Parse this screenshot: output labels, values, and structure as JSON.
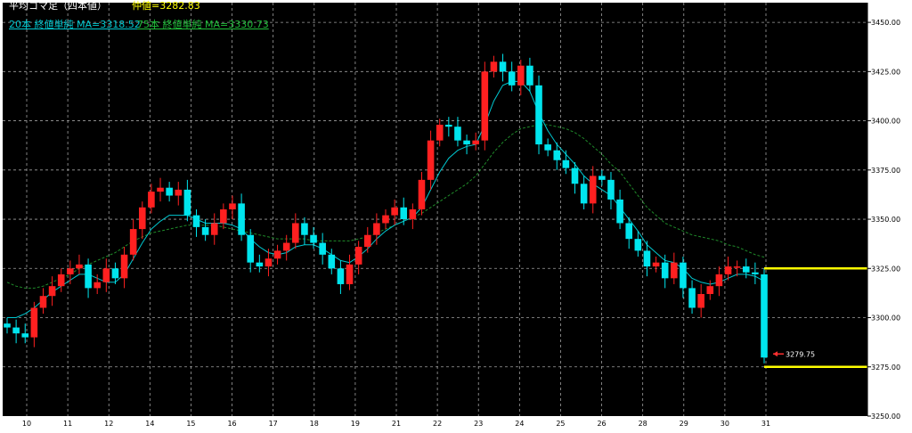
{
  "header": {
    "title": "平均コマ足（四本値）",
    "mid_price": "仲値=3282.83",
    "ma20_label": "20本 終値単純 MA=3318.52",
    "ma75_label": "75本 終値単純 MA=3330.73"
  },
  "colors": {
    "background": "#000000",
    "grid": "#a0a0a0",
    "up_candle": "#ff2020",
    "down_candle": "#00e5ee",
    "ma20": "#00c8d0",
    "ma75": "#1f8a2a",
    "price_line": "#ffff00",
    "title_text": "#ffffff",
    "mid_price_text": "#ffff00",
    "axis_text": "#ffffff"
  },
  "chart_data": {
    "type": "line",
    "title": "平均コマ足（四本値）",
    "ylim": [
      3250,
      3460
    ],
    "y_ticks": [
      "3450.00",
      "3425.00",
      "3400.00",
      "3375.00",
      "3350.00",
      "3325.00",
      "3300.00",
      "3275.00",
      "3250.00"
    ],
    "x_ticks": [
      "10",
      "11",
      "12",
      "14",
      "15",
      "16",
      "17",
      "18",
      "19",
      "21",
      "22",
      "23",
      "24",
      "25",
      "26",
      "28",
      "29",
      "30",
      "31"
    ],
    "series": [
      {
        "name": "平均コマ足",
        "kind": "candles",
        "values": [
          3295,
          3292,
          3290,
          3305,
          3311,
          3316,
          3322,
          3325,
          3327,
          3315,
          3318,
          3325,
          3320,
          3332,
          3345,
          3356,
          3364,
          3366,
          3362,
          3365,
          3352,
          3346,
          3342,
          3348,
          3355,
          3358,
          3342,
          3328,
          3326,
          3330,
          3334,
          3338,
          3348,
          3342,
          3338,
          3332,
          3325,
          3317,
          3327,
          3336,
          3342,
          3348,
          3352,
          3356,
          3350,
          3355,
          3370,
          3390,
          3398,
          3397,
          3390,
          3388,
          3390,
          3425,
          3430,
          3425,
          3418,
          3428,
          3418,
          3388,
          3385,
          3380,
          3376,
          3368,
          3358,
          3372,
          3370,
          3360,
          3348,
          3340,
          3334,
          3326,
          3328,
          3320,
          3328,
          3315,
          3305,
          3312,
          3316,
          3322,
          3326,
          3326,
          3323,
          3322,
          3279.75
        ]
      },
      {
        "name": "20本 終値単純 MA",
        "kind": "line",
        "values": [
          3300,
          3300,
          3302,
          3305,
          3309,
          3313,
          3316,
          3319,
          3322,
          3322,
          3320,
          3318,
          3318,
          3322,
          3330,
          3338,
          3345,
          3349,
          3352,
          3352,
          3352,
          3350,
          3348,
          3348,
          3348,
          3347,
          3345,
          3340,
          3336,
          3333,
          3332,
          3333,
          3336,
          3337,
          3337,
          3335,
          3332,
          3329,
          3328,
          3331,
          3335,
          3340,
          3344,
          3347,
          3349,
          3351,
          3356,
          3365,
          3374,
          3381,
          3385,
          3387,
          3388,
          3398,
          3410,
          3418,
          3420,
          3420,
          3415,
          3404,
          3395,
          3388,
          3383,
          3378,
          3372,
          3368,
          3365,
          3362,
          3356,
          3350,
          3344,
          3337,
          3333,
          3329,
          3328,
          3325,
          3320,
          3318,
          3317,
          3318,
          3320,
          3322,
          3322,
          3321,
          3318.52
        ]
      },
      {
        "name": "75本 終値単純 MA",
        "kind": "line",
        "values": [
          3318,
          3316,
          3315,
          3315,
          3316,
          3318,
          3320,
          3322,
          3325,
          3327,
          3329,
          3331,
          3333,
          3336,
          3339,
          3341,
          3343,
          3344,
          3345,
          3346,
          3347,
          3347,
          3347,
          3347,
          3346,
          3345,
          3344,
          3343,
          3342,
          3341,
          3340,
          3340,
          3340,
          3340,
          3339,
          3339,
          3339,
          3339,
          3339,
          3340,
          3341,
          3343,
          3345,
          3347,
          3349,
          3351,
          3353,
          3356,
          3359,
          3362,
          3365,
          3368,
          3372,
          3378,
          3384,
          3389,
          3393,
          3396,
          3397,
          3398,
          3398,
          3397,
          3396,
          3394,
          3391,
          3387,
          3383,
          3378,
          3374,
          3368,
          3362,
          3356,
          3352,
          3348,
          3346,
          3344,
          3342,
          3341,
          3340,
          3339,
          3337,
          3336,
          3334,
          3332,
          3330.73
        ]
      }
    ],
    "annotations": [
      "3279.75"
    ],
    "horizontal_lines": [
      3325,
      3275
    ],
    "grid": true
  }
}
